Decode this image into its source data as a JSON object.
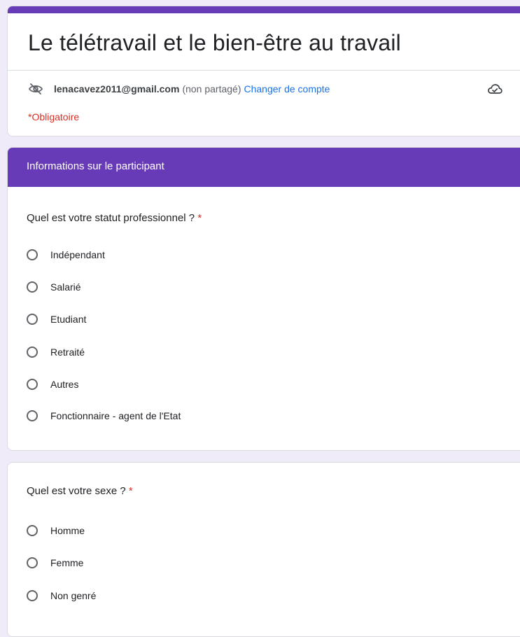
{
  "form": {
    "title": "Le télétravail et le bien-être au travail",
    "account": {
      "email": "lenacavez2011@gmail.com",
      "shared_status": "(non partagé)",
      "switch_label": "Changer de compte"
    },
    "required_note": "*Obligatoire"
  },
  "section": {
    "title": "Informations sur le participant"
  },
  "questions": [
    {
      "title": "Quel est votre statut professionnel ?",
      "required_mark": "*",
      "options": [
        "Indépendant",
        "Salarié",
        "Etudiant",
        "Retraité",
        "Autres",
        "Fonctionnaire - agent de l'Etat"
      ]
    },
    {
      "title": "Quel est votre sexe ?",
      "required_mark": "*",
      "options": [
        "Homme",
        "Femme",
        "Non genré"
      ]
    }
  ],
  "colors": {
    "accent": "#673ab7",
    "background": "#f0ebf8",
    "required": "#d93025",
    "link": "#1a73e8"
  },
  "icons": {
    "visibility": "eye-off-icon",
    "save_status": "cloud-done-icon"
  }
}
